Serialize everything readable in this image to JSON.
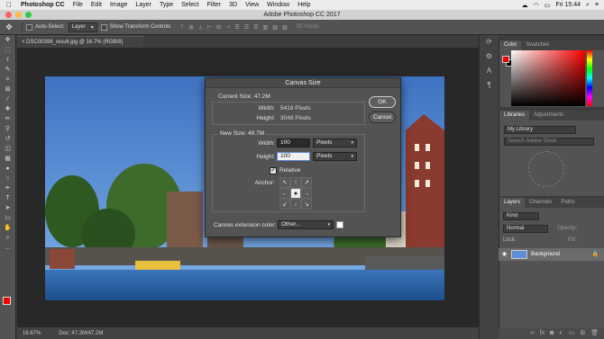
{
  "menubar": {
    "app": "Photoshop CC",
    "items": [
      "File",
      "Edit",
      "Image",
      "Layer",
      "Type",
      "Select",
      "Filter",
      "3D",
      "View",
      "Window",
      "Help"
    ],
    "time": "Fri 15:44"
  },
  "window": {
    "title": "Adobe Photoshop CC 2017"
  },
  "options": {
    "auto_select_label": "Auto-Select:",
    "auto_select_value": "Layer",
    "transform_label": "Show Transform Controls",
    "mode3d_label": "3D Mode:"
  },
  "document": {
    "tab": "DSC00399_result.jpg @ 16.7% (RGB/8)",
    "zoom": "16.67%",
    "doc_info": "Doc: 47.2M/47.2M"
  },
  "dialog": {
    "title": "Canvas Size",
    "current_size_label": "Current Size: 47.2M",
    "width_label": "Width:",
    "height_label": "Height:",
    "current_width": "5418 Pixels",
    "current_height": "3048 Pixels",
    "new_size_label": "New Size: 49.7M",
    "new_width": "100",
    "new_height": "100",
    "unit": "Pixels",
    "relative_label": "Relative",
    "relative_checked": true,
    "anchor_label": "Anchor:",
    "extension_label": "Canvas extension color:",
    "extension_value": "Other...",
    "ok": "OK",
    "cancel": "Cancel"
  },
  "panels": {
    "color_tab": "Color",
    "swatches_tab": "Swatches",
    "libraries_tab": "Libraries",
    "adjustments_tab": "Adjustments",
    "library_value": "My Library",
    "library_search": "Search Adobe Stock",
    "layers_tab": "Layers",
    "channels_tab": "Channels",
    "paths_tab": "Paths",
    "kind": "Kind",
    "blend": "Normal",
    "opacity": "Opacity:",
    "lock": "Lock:",
    "fill": "Fill:",
    "layer_name": "Background"
  },
  "colors": {
    "foreground": "#e00000",
    "background": "#000000",
    "accent": "#5b8ad8"
  }
}
